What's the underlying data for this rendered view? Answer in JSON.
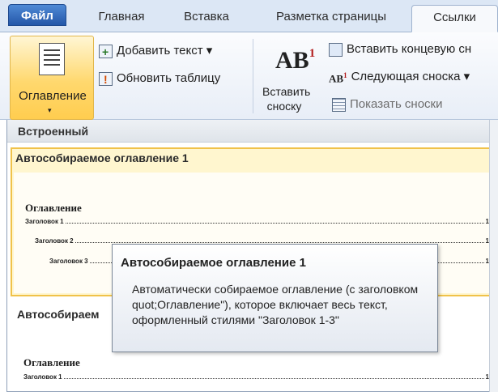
{
  "tabs": {
    "file": "Файл",
    "home": "Главная",
    "insert": "Вставка",
    "layout": "Разметка страницы",
    "references": "Ссылки"
  },
  "ribbon": {
    "toc_button": "Оглавление",
    "toc_arrow": "▾",
    "add_text": "Добавить текст ▾",
    "update_table": "Обновить таблицу",
    "insert_footnote_line1": "Вставить",
    "insert_footnote_line2": "сноску",
    "insert_endnote": "Вставить концевую сн",
    "next_footnote": "Следующая сноска ▾",
    "show_notes": "Показать сноски",
    "ab_text": "AB",
    "ab_sup": "1",
    "ab_small_text": "AB",
    "ab_small_sup": "1"
  },
  "gallery": {
    "header": "Встроенный",
    "items": [
      {
        "title": "Автособираемое оглавление 1",
        "preview_heading": "Оглавление",
        "entries": [
          {
            "text": "Заголовок 1",
            "page": "1"
          },
          {
            "text": "Заголовок 2",
            "page": "1"
          },
          {
            "text": "Заголовок 3",
            "page": "1"
          }
        ]
      },
      {
        "title": "Автособираем",
        "preview_heading": "Оглавление",
        "entries": [
          {
            "text": "Заголовок 1",
            "page": "1"
          }
        ]
      }
    ]
  },
  "tooltip": {
    "title": "Автособираемое оглавление 1",
    "body": "Автоматически собираемое оглавление (с заголовком quot;Оглавление\"), которое включает весь текст, оформленный стилями \"Заголовок 1-3\""
  }
}
